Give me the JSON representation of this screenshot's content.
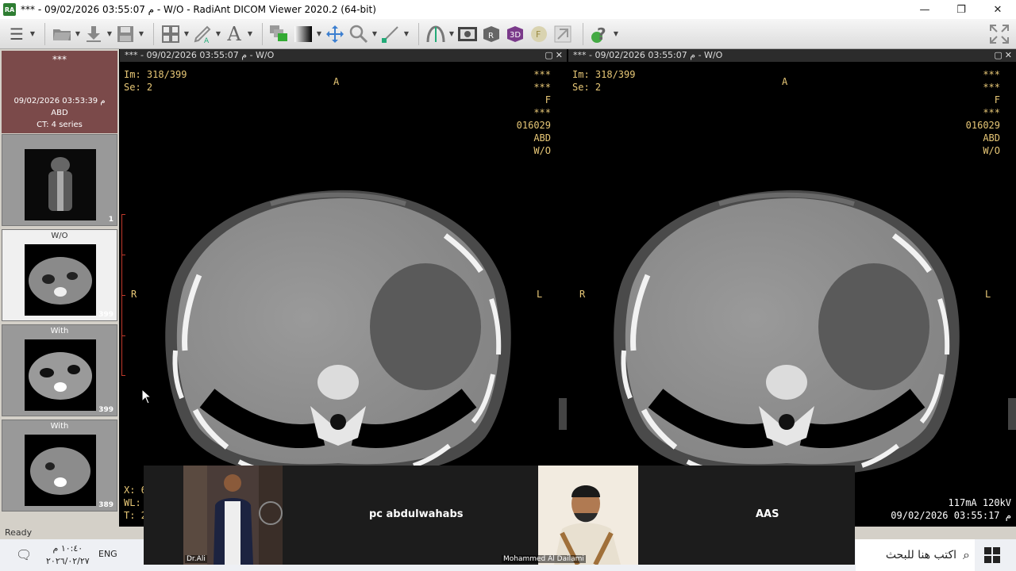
{
  "window": {
    "icon_text": "RA",
    "title": "*** - 09/02/2026 03:55:07 م - W/O - RadiAnt DICOM Viewer 2020.2 (64-bit)",
    "minimize": "—",
    "restore": "❐",
    "close": "✕"
  },
  "toolbar": {
    "icons": [
      "menu-icon",
      "open-folder-icon",
      "download-icon",
      "save-icon",
      "layout-grid-icon",
      "annotation-pen-icon",
      "text-icon",
      "series-stack-icon",
      "window-level-icon",
      "pan-icon",
      "zoom-icon",
      "measure-icon",
      "mpr-icon",
      "screenshot-icon",
      "mpr-r-icon",
      "3d-icon",
      "fusion-icon",
      "tools-icon",
      "help-icon",
      "fullscreen-icon"
    ],
    "text_tool_label": "A",
    "volume_label": "3D",
    "fusion_label": "F"
  },
  "study": {
    "patient": "***",
    "date": "09/02/2026 03:53:39 م",
    "description": "ABD",
    "modality": "CT: 4 series"
  },
  "series": [
    {
      "label": "",
      "count": "1",
      "active": false
    },
    {
      "label": "W/O",
      "count": "399",
      "active": true
    },
    {
      "label": "With",
      "count": "399",
      "active": false
    },
    {
      "label": "With",
      "count": "389",
      "active": false
    }
  ],
  "viewports": [
    {
      "header": "*** - 09/02/2026 03:55:07 م - W/O",
      "image_num": "Im: 318/399",
      "series_num": "Se: 2",
      "orient_top": "A",
      "orient_left": "R",
      "orient_right": "L",
      "info_right": [
        "***",
        "***",
        "F",
        "***",
        "016029",
        "ABD",
        "W/O"
      ],
      "bottom_left": [
        "X: 6",
        "WL:",
        "T: 2"
      ],
      "bottom_right": []
    },
    {
      "header": "*** - 09/02/2026 03:55:07 م - W/O",
      "image_num": "Im: 318/399",
      "series_num": "Se: 2",
      "orient_top": "A",
      "orient_left": "R",
      "orient_right": "L",
      "info_right": [
        "***",
        "***",
        "F",
        "***",
        "016029",
        "ABD",
        "W/O"
      ],
      "bottom_left": [],
      "bottom_right": [
        "117mA 120kV",
        "09/02/2026 03:55:17 م"
      ]
    }
  ],
  "status": {
    "text": "Ready"
  },
  "meeting": {
    "tiles": [
      {
        "name": "Dr.Ali"
      },
      {
        "name": "pc abdulwahabs"
      },
      {
        "name": "Mohammed Al Dailami"
      },
      {
        "name": "AAS"
      }
    ]
  },
  "taskbar": {
    "time": "١٠:٤٠ م",
    "date": "٢٠٢٦/٠٢/٢٧",
    "language": "ENG",
    "search_placeholder": "اكتب هنا للبحث",
    "colors": {
      "accent": "#0a64d2"
    }
  }
}
